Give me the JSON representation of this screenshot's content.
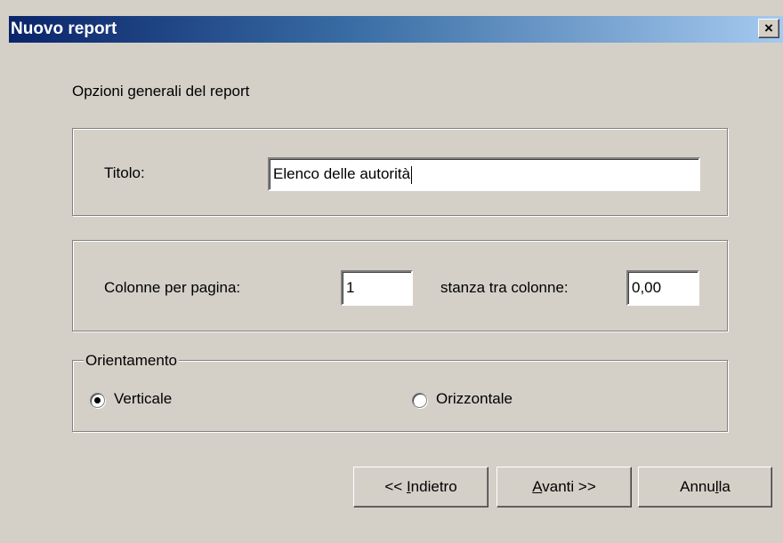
{
  "window": {
    "title": "Nuovo report",
    "close_label": "×"
  },
  "header": {
    "subtitle": "Opzioni generali del report"
  },
  "title_group": {
    "label": "Titolo:",
    "value": "Elenco delle autorità"
  },
  "columns_group": {
    "columns_label": "Colonne per pagina:",
    "columns_value": "1",
    "spacing_label": "stanza tra colonne:",
    "spacing_value": "0,00"
  },
  "orientation": {
    "legend": "Orientamento",
    "options": [
      {
        "label": "Verticale",
        "selected": true
      },
      {
        "label": "Orizzontale",
        "selected": false
      }
    ]
  },
  "buttons": {
    "back": {
      "prefix": "<< ",
      "mnemonic": "I",
      "rest": "ndietro"
    },
    "next": {
      "prefix": "",
      "mnemonic": "A",
      "rest": "vanti >>"
    },
    "cancel": {
      "prefix": "Annu",
      "mnemonic": "l",
      "rest": "la"
    }
  }
}
